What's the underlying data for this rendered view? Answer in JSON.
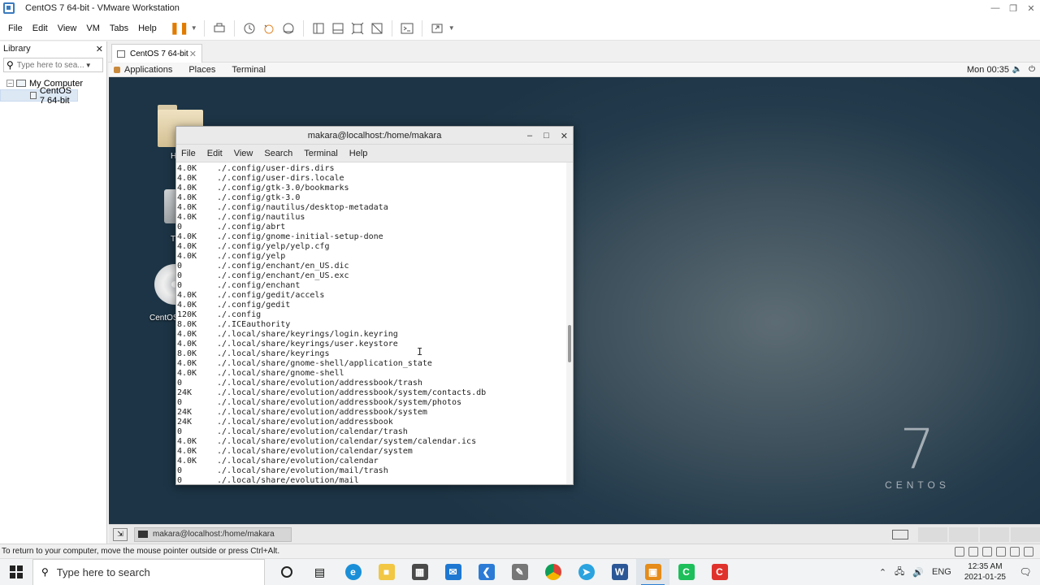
{
  "window": {
    "title": "CentOS 7 64-bit - VMware Workstation"
  },
  "menubar": {
    "items": [
      "File",
      "Edit",
      "View",
      "VM",
      "Tabs",
      "Help"
    ]
  },
  "library": {
    "title": "Library",
    "search_placeholder": "Type here to sea...",
    "tree": [
      {
        "label": "My Computer"
      },
      {
        "label": "CentOS 7 64-bit"
      }
    ]
  },
  "vm_tab": {
    "label": "CentOS 7 64-bit"
  },
  "gnome": {
    "applications": "Applications",
    "places": "Places",
    "terminal": "Terminal",
    "clock": "Mon 00:35"
  },
  "desktop": {
    "home_label": "H",
    "trash_label": "T",
    "disc_label": "CentOS",
    "brand_number": "7",
    "brand_word": "CENTOS"
  },
  "terminal": {
    "title": "makara@localhost:/home/makara",
    "menu": [
      "File",
      "Edit",
      "View",
      "Search",
      "Terminal",
      "Help"
    ],
    "lines": [
      {
        "size": "4.0K",
        "path": "./.config/user-dirs.dirs"
      },
      {
        "size": "4.0K",
        "path": "./.config/user-dirs.locale"
      },
      {
        "size": "4.0K",
        "path": "./.config/gtk-3.0/bookmarks"
      },
      {
        "size": "4.0K",
        "path": "./.config/gtk-3.0"
      },
      {
        "size": "4.0K",
        "path": "./.config/nautilus/desktop-metadata"
      },
      {
        "size": "4.0K",
        "path": "./.config/nautilus"
      },
      {
        "size": "0",
        "path": "./.config/abrt"
      },
      {
        "size": "4.0K",
        "path": "./.config/gnome-initial-setup-done"
      },
      {
        "size": "4.0K",
        "path": "./.config/yelp/yelp.cfg"
      },
      {
        "size": "4.0K",
        "path": "./.config/yelp"
      },
      {
        "size": "0",
        "path": "./.config/enchant/en_US.dic"
      },
      {
        "size": "0",
        "path": "./.config/enchant/en_US.exc"
      },
      {
        "size": "0",
        "path": "./.config/enchant"
      },
      {
        "size": "4.0K",
        "path": "./.config/gedit/accels"
      },
      {
        "size": "4.0K",
        "path": "./.config/gedit"
      },
      {
        "size": "120K",
        "path": "./.config"
      },
      {
        "size": "8.0K",
        "path": "./.ICEauthority"
      },
      {
        "size": "4.0K",
        "path": "./.local/share/keyrings/login.keyring"
      },
      {
        "size": "4.0K",
        "path": "./.local/share/keyrings/user.keystore"
      },
      {
        "size": "8.0K",
        "path": "./.local/share/keyrings"
      },
      {
        "size": "4.0K",
        "path": "./.local/share/gnome-shell/application_state"
      },
      {
        "size": "4.0K",
        "path": "./.local/share/gnome-shell"
      },
      {
        "size": "0",
        "path": "./.local/share/evolution/addressbook/trash"
      },
      {
        "size": "24K",
        "path": "./.local/share/evolution/addressbook/system/contacts.db"
      },
      {
        "size": "0",
        "path": "./.local/share/evolution/addressbook/system/photos"
      },
      {
        "size": "24K",
        "path": "./.local/share/evolution/addressbook/system"
      },
      {
        "size": "24K",
        "path": "./.local/share/evolution/addressbook"
      },
      {
        "size": "0",
        "path": "./.local/share/evolution/calendar/trash"
      },
      {
        "size": "4.0K",
        "path": "./.local/share/evolution/calendar/system/calendar.ics"
      },
      {
        "size": "4.0K",
        "path": "./.local/share/evolution/calendar/system"
      },
      {
        "size": "4.0K",
        "path": "./.local/share/evolution/calendar"
      },
      {
        "size": "0",
        "path": "./.local/share/evolution/mail/trash"
      },
      {
        "size": "0",
        "path": "./.local/share/evolution/mail"
      }
    ]
  },
  "guest_taskbar": {
    "terminal_task": "makara@localhost:/home/makara"
  },
  "status": {
    "message": "To return to your computer, move the mouse pointer outside or press Ctrl+Alt."
  },
  "taskbar": {
    "search_placeholder": "Type here to search",
    "language": "ENG",
    "time": "12:35 AM",
    "date": "2021-01-25"
  }
}
